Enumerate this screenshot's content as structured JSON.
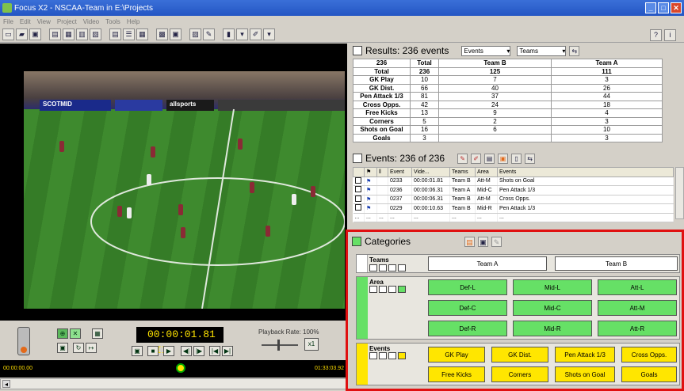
{
  "window": {
    "title": "Focus X2 - NSCAA-Team in E:\\Projects"
  },
  "menu": [
    "File",
    "Edit",
    "View",
    "Project",
    "Video",
    "Tools",
    "Help"
  ],
  "video": {
    "timecode": "00:00:01.81",
    "pause_glyph": "II",
    "playback_rate_label": "Playback Rate: 100%",
    "rate_button": "x1",
    "timeline_start": "00:00:00.00",
    "timeline_end": "01:33:03.92",
    "adboards": [
      "SCOTMID",
      "allsports"
    ]
  },
  "results": {
    "title": "Results: 236 events",
    "dropdown1": "Events",
    "dropdown2": "Teams",
    "headers": [
      "236",
      "Total",
      "Team B",
      "Team A"
    ],
    "rows": [
      [
        "Total",
        "236",
        "125",
        "111"
      ],
      [
        "GK Play",
        "10",
        "7",
        "3"
      ],
      [
        "GK Dist.",
        "66",
        "40",
        "26"
      ],
      [
        "Pen Attack 1/3",
        "81",
        "37",
        "44"
      ],
      [
        "Cross Opps.",
        "42",
        "24",
        "18"
      ],
      [
        "Free Kicks",
        "13",
        "9",
        "4"
      ],
      [
        "Corners",
        "5",
        "2",
        "3"
      ],
      [
        "Shots on Goal",
        "16",
        "6",
        "10"
      ],
      [
        "Goals",
        "3",
        "",
        "3"
      ]
    ]
  },
  "events": {
    "title": "Events: 236 of 236",
    "headers": [
      "Event",
      "Vide...",
      "Teams",
      "Area",
      "Events"
    ],
    "rows": [
      [
        "0233",
        "00:00:01.81",
        "Team B",
        "Att-M",
        "Shots on Goal"
      ],
      [
        "0236",
        "00:00:06.31",
        "Team A",
        "Mid-C",
        "Pen Attack 1/3"
      ],
      [
        "0237",
        "00:00:06.31",
        "Team B",
        "Att-M",
        "Cross Opps."
      ],
      [
        "0229",
        "00:00:10.63",
        "Team B",
        "Mid-R",
        "Pen Attack 1/3"
      ]
    ],
    "ellipsis": "..."
  },
  "categories": {
    "title": "Categories",
    "teams_label": "Teams",
    "teams": [
      "Team A",
      "Team B"
    ],
    "area_label": "Area",
    "areas": [
      "Def-L",
      "Mid-L",
      "Att-L",
      "Def-C",
      "Mid-C",
      "Att-M",
      "Def-R",
      "Mid-R",
      "Att-R"
    ],
    "events_label": "Events",
    "events": [
      "GK Play",
      "GK Dist.",
      "Pen Attack 1/3",
      "Cross Opps.",
      "Free Kicks",
      "Corners",
      "Shots on Goal",
      "Goals"
    ]
  },
  "colors": {
    "highlight_border": "#e01010",
    "area_green": "#66e066",
    "event_yellow": "#ffe600",
    "titlebar": "#2456c4"
  }
}
